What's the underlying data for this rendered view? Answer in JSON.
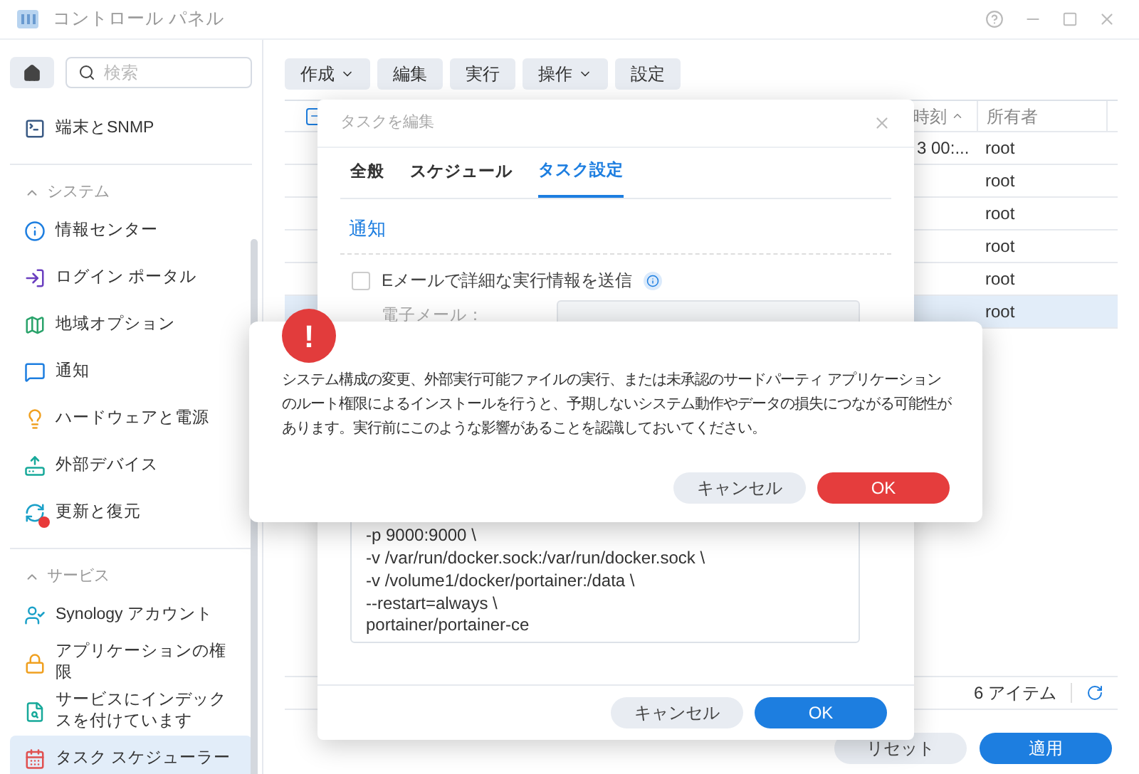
{
  "window": {
    "title": "コントロール パネル"
  },
  "sidebar": {
    "search": {
      "placeholder": "検索"
    },
    "items": [
      {
        "kind": "item",
        "label": "端末とSNMP",
        "selected": false,
        "alert": false
      },
      {
        "kind": "section",
        "label": "システム",
        "expanded": true,
        "children": [
          {
            "kind": "item",
            "label": "情報センター",
            "selected": false,
            "alert": false
          },
          {
            "kind": "item",
            "label": "ログイン ポータル",
            "selected": false,
            "alert": false
          },
          {
            "kind": "item",
            "label": "地域オプション",
            "selected": false,
            "alert": false
          },
          {
            "kind": "item",
            "label": "通知",
            "selected": false,
            "alert": false
          },
          {
            "kind": "item",
            "label": "ハードウェアと電源",
            "selected": false,
            "alert": false
          },
          {
            "kind": "item",
            "label": "外部デバイス",
            "selected": false,
            "alert": false
          },
          {
            "kind": "item",
            "label": "更新と復元",
            "selected": false,
            "alert": true
          }
        ]
      },
      {
        "kind": "section",
        "label": "サービス",
        "expanded": true,
        "children": [
          {
            "kind": "item",
            "label": "Synology アカウント",
            "selected": false,
            "alert": false
          },
          {
            "kind": "item",
            "label": "アプリケーションの権限",
            "selected": false,
            "alert": false
          },
          {
            "kind": "item",
            "label": "サービスにインデックスを付けています",
            "selected": false,
            "alert": false
          },
          {
            "kind": "item",
            "label": "タスク スケジューラー",
            "selected": true,
            "alert": false
          }
        ]
      }
    ]
  },
  "toolbar": [
    {
      "label": "作成",
      "dropdown": true
    },
    {
      "label": "編集",
      "dropdown": false
    },
    {
      "label": "実行",
      "dropdown": false
    },
    {
      "label": "操作",
      "dropdown": true
    },
    {
      "label": "設定",
      "dropdown": false
    }
  ],
  "table": {
    "header_checkbox": {
      "indeterminate": true
    },
    "columns": [
      "時刻",
      "所有者"
    ],
    "rows": [
      {
        "time": "3 00:...",
        "owner": "root",
        "selected": false
      },
      {
        "owner": "root",
        "selected": false
      },
      {
        "owner": "root",
        "selected": false
      },
      {
        "owner": "root",
        "selected": false
      },
      {
        "owner": "root",
        "selected": false
      },
      {
        "owner": "root",
        "selected": true
      }
    ],
    "item_count": "6 アイテム"
  },
  "footer_buttons": [
    {
      "label": "リセット",
      "primary": false
    },
    {
      "label": "適用",
      "primary": true
    }
  ],
  "edit_dialog": {
    "title": "タスクを編集",
    "tabs": [
      {
        "label": "全般",
        "selected": false
      },
      {
        "label": "スケジュール",
        "selected": false
      },
      {
        "label": "タスク設定",
        "selected": true
      }
    ],
    "section": "通知",
    "email_checkbox": {
      "label": "Eメールで詳細な実行情報を送信",
      "checked": false
    },
    "email_label": "電子メール：",
    "command_lines": [
      "-p 9000:9000 \\",
      "-v /var/run/docker.sock:/var/run/docker.sock \\",
      "-v /volume1/docker/portainer:/data \\",
      "--restart=always \\",
      "portainer/portainer-ce"
    ],
    "buttons": [
      {
        "label": "キャンセル",
        "primary": false
      },
      {
        "label": "OK",
        "primary": true
      }
    ]
  },
  "alert": {
    "symbol": "!",
    "message": "システム構成の変更、外部実行可能ファイルの実行、または未承認のサードパーティ アプリケーションのルート権限によるインストールを行うと、予期しないシステム動作やデータの損失につながる可能性があります。実行前にこのような影響があることを認識しておいてください。",
    "buttons": [
      {
        "label": "キャンセル",
        "kind": "cancel"
      },
      {
        "label": "OK",
        "kind": "danger"
      }
    ]
  }
}
